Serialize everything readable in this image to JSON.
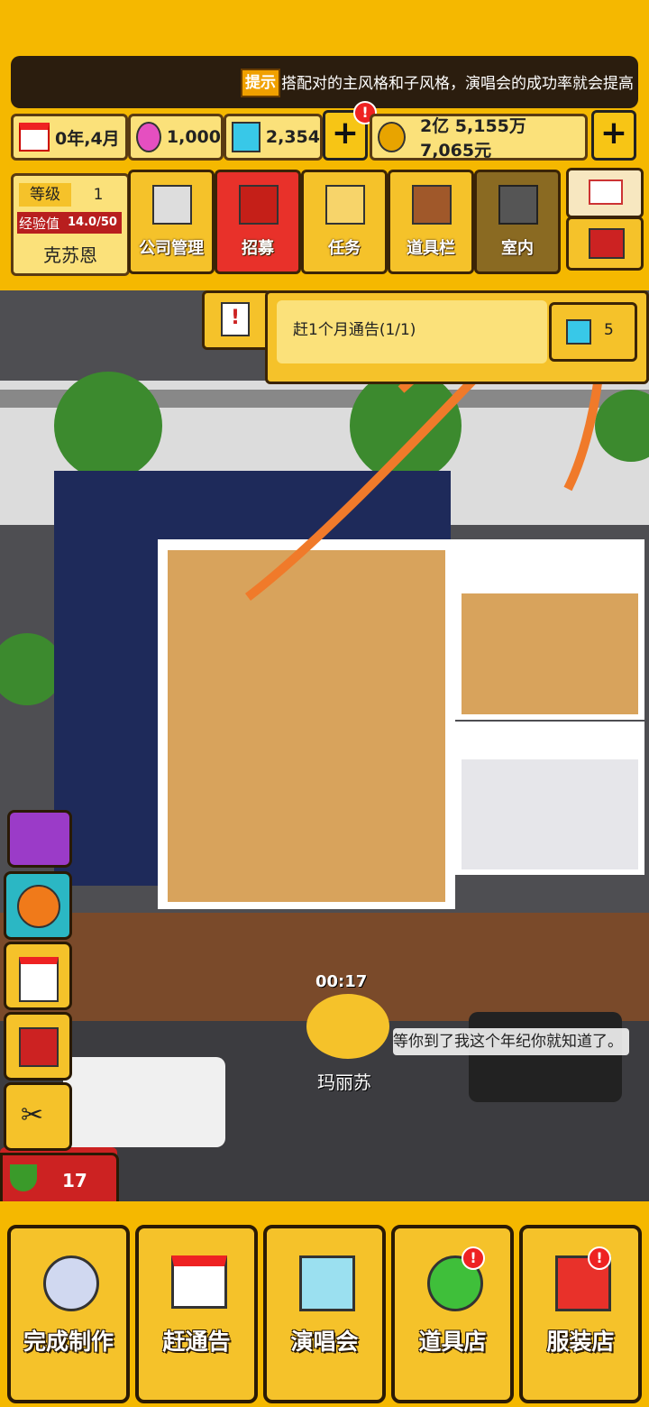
{
  "tip": {
    "tag": "提示",
    "text": "搭配对的主风格和子风格，演唱会的成功率就会提高"
  },
  "resources": {
    "date": "0年,4月",
    "gems_pink": "1,000",
    "gems_blue": "2,354",
    "money": "2亿 5,155万 7,065元",
    "alert": "!"
  },
  "player": {
    "level_label": "等级",
    "level_value": "1",
    "exp_label": "经验值",
    "exp_value": "14.0/50",
    "name": "克苏恩"
  },
  "menu": [
    {
      "label": "公司管理"
    },
    {
      "label": "招募"
    },
    {
      "label": "任务"
    },
    {
      "label": "道具栏"
    },
    {
      "label": "室内"
    }
  ],
  "quest": {
    "text": "赶1个月通告(1/1)",
    "reward": "5",
    "icon": "!"
  },
  "scene": {
    "timer": "00:17",
    "npc_name": "玛丽苏",
    "speech": "等你到了我这个年纪你就知道了。",
    "watermelon_count": "17"
  },
  "bottom": [
    {
      "label": "完成制作"
    },
    {
      "label": "赶通告"
    },
    {
      "label": "演唱会"
    },
    {
      "label": "道具店"
    },
    {
      "label": "服装店"
    }
  ],
  "colors": {
    "accent": "#f5b800",
    "recruit_red": "#e8312a",
    "dark": "#2b1d0e",
    "annotation": "#f07a2a"
  }
}
